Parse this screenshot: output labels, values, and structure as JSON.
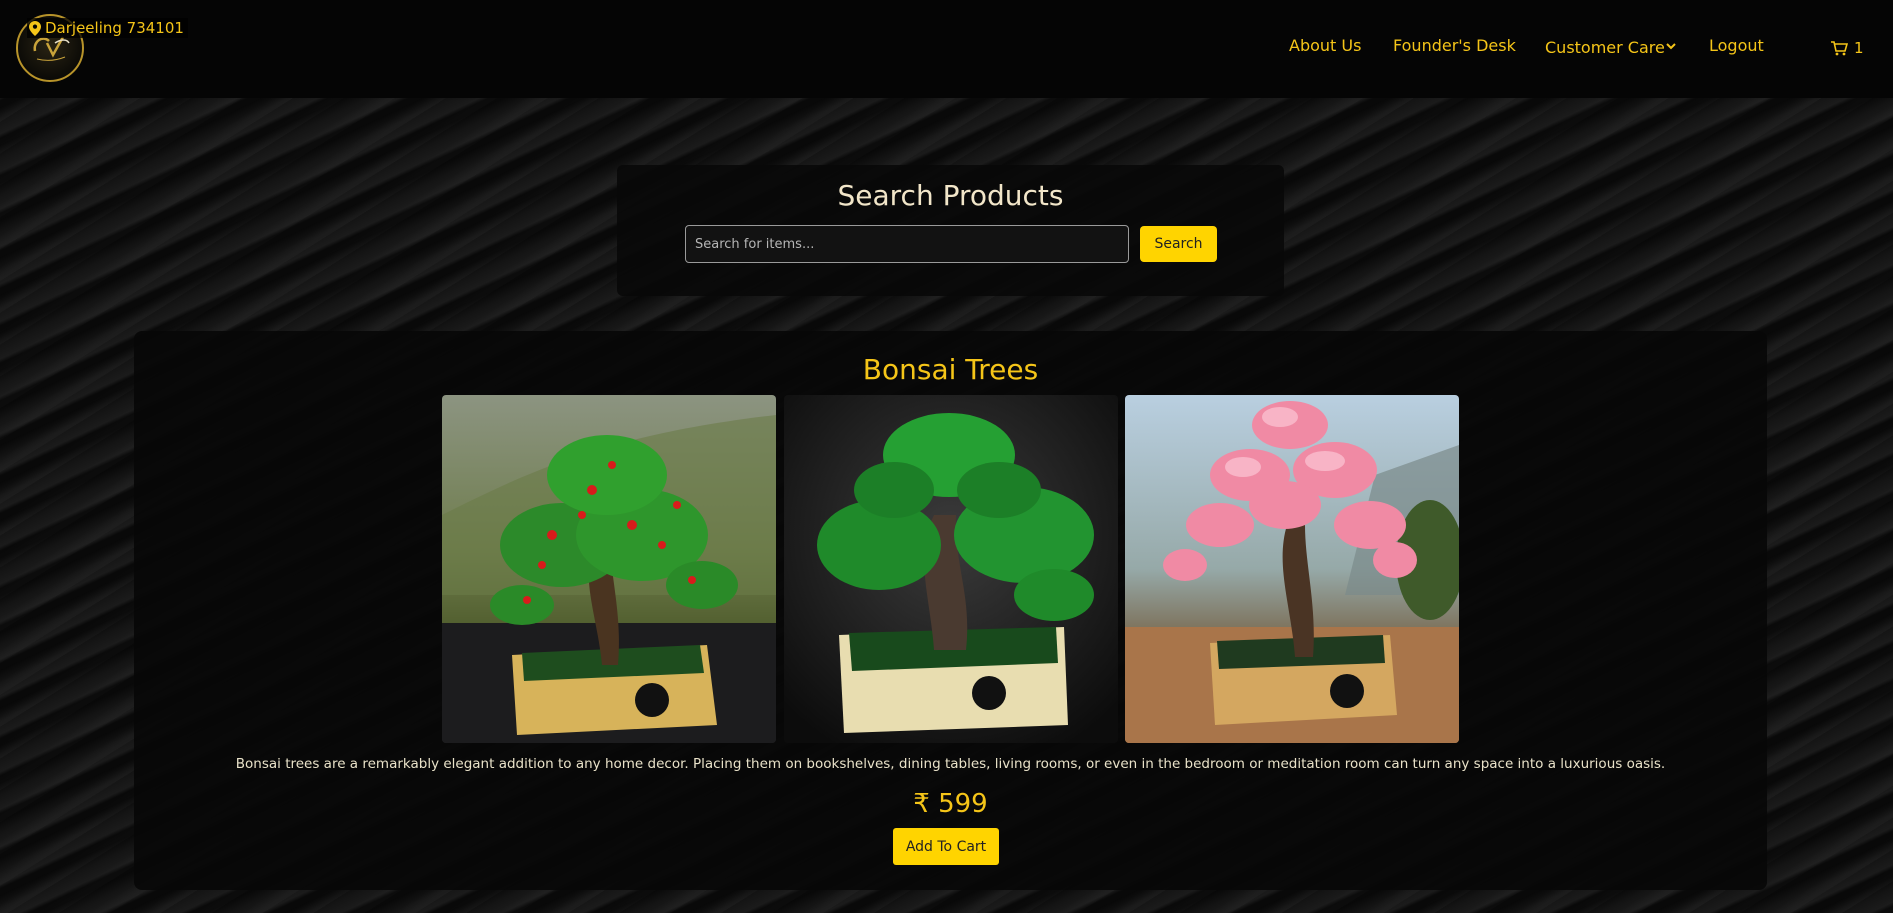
{
  "nav": {
    "location": "Darjeeling 734101",
    "links": [
      "About Us",
      "Founder's Desk",
      "Customer Care",
      "Logout"
    ],
    "cart_count": "1"
  },
  "search": {
    "title": "Search Products",
    "placeholder": "Search for items...",
    "button": "Search"
  },
  "product": {
    "title": "Bonsai Trees",
    "description": "Bonsai trees are a remarkably elegant addition to any home decor. Placing them on bookshelves, dining tables, living rooms, or even in the bedroom or meditation room can turn any space into a luxurious oasis.",
    "price": "₹ 599",
    "add_button": "Add To Cart",
    "images": [
      "bonsai-red-flowers",
      "bonsai-green",
      "bonsai-pink-blossom"
    ]
  },
  "colors": {
    "accent": "#f5c518",
    "button": "#ffd400",
    "background": "#141414"
  }
}
